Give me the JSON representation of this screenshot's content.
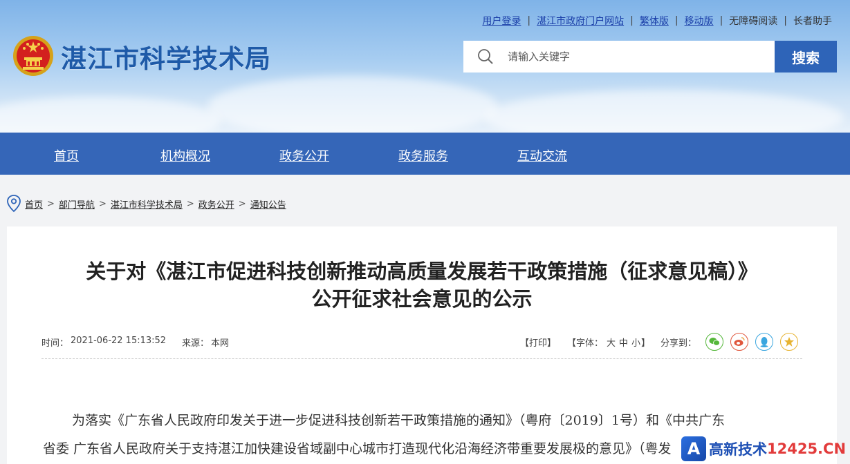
{
  "header": {
    "site_title": "湛江市科学技术局",
    "top_links": [
      "用户登录",
      "湛江市政府门户网站",
      "繁体版",
      "移动版"
    ],
    "top_plain": [
      "无障碍阅读",
      "长者助手"
    ],
    "search": {
      "placeholder": "请输入关键字",
      "button": "搜索"
    }
  },
  "nav": [
    "首页",
    "机构概况",
    "政务公开",
    "政务服务",
    "互动交流"
  ],
  "breadcrumb": [
    "首页",
    "部门导航",
    "湛江市科学技术局",
    "政务公开",
    "通知公告"
  ],
  "article": {
    "title_line1": "关于对《湛江市促进科技创新推动高质量发展若干政策措施（征求意见稿）》",
    "title_line2": "公开征求社会意见的公示",
    "time_label": "时间：",
    "time": "2021-06-22 15:13:52",
    "source_label": "来源：",
    "source": "本网",
    "print": "【打印】",
    "font_label": "【字体：",
    "font_sizes": [
      "大",
      "中",
      "小"
    ],
    "font_end": "】",
    "share_label": "分享到：",
    "share_icons": [
      "wechat-icon",
      "weibo-icon",
      "qq-icon",
      "qzone-icon"
    ],
    "body_line1": "为落实《广东省人民政府印发关于进一步促进科技创新若干政策措施的通知》（粤府〔2019〕1号）和《中共广东",
    "body_line2": "省委 广东省人民政府关于支持湛江加快建设省域副中心城市打造现代化沿海经济带重要发展极的意见》（粤发"
  },
  "watermark": {
    "logo": "A",
    "text": "高新技术",
    "domain": "12425.CN"
  },
  "colors": {
    "nav_bg": "#3566b8",
    "search_btn": "#2e64b8",
    "title_blue": "#1e5aa8"
  }
}
